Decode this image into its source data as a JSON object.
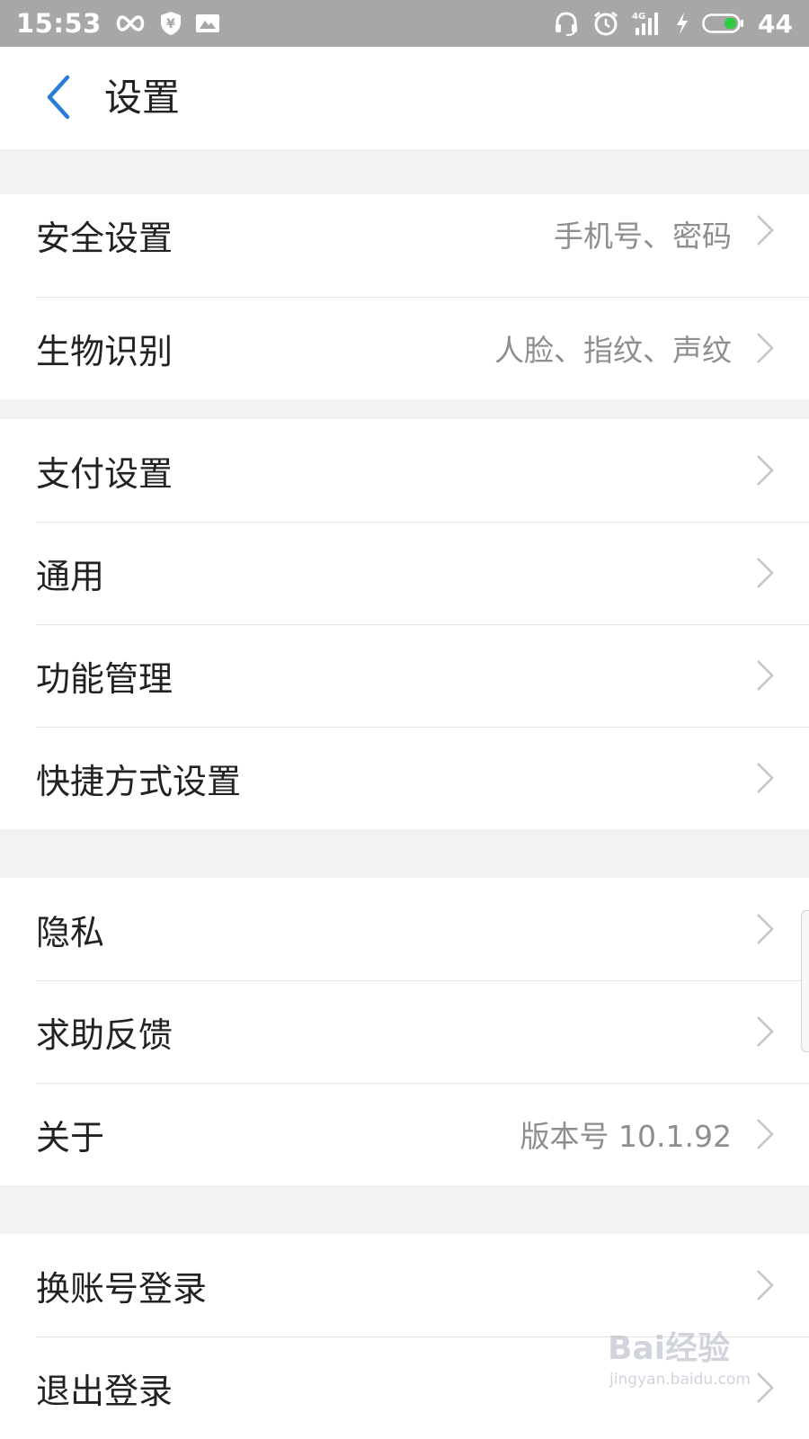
{
  "status_bar": {
    "time": "15:53",
    "battery_level": "44",
    "left_icons": [
      "infinity-icon",
      "shield-yen-icon",
      "photo-icon"
    ],
    "right_icons": [
      "headset-icon",
      "alarm-icon",
      "signal-4g-icon",
      "charging-icon",
      "battery-icon"
    ],
    "battery_color": "#2ecc40"
  },
  "header": {
    "title": "设置",
    "back_icon": "chevron-left-icon",
    "accent_color": "#2b7cd9"
  },
  "groups": [
    {
      "rows": [
        {
          "label": "安全设置",
          "value": "手机号、密码"
        },
        {
          "label": "生物识别",
          "value": "人脸、指纹、声纹"
        }
      ]
    },
    {
      "rows": [
        {
          "label": "支付设置",
          "value": ""
        },
        {
          "label": "通用",
          "value": ""
        },
        {
          "label": "功能管理",
          "value": ""
        },
        {
          "label": "快捷方式设置",
          "value": ""
        }
      ]
    },
    {
      "rows": [
        {
          "label": "隐私",
          "value": ""
        },
        {
          "label": "求助反馈",
          "value": ""
        },
        {
          "label": "关于",
          "value": "版本号 10.1.92"
        }
      ]
    },
    {
      "rows": [
        {
          "label": "换账号登录",
          "value": ""
        },
        {
          "label": "退出登录",
          "value": ""
        }
      ]
    }
  ],
  "watermark": {
    "main": "Bai经验",
    "sub": "jingyan.baidu.com"
  }
}
